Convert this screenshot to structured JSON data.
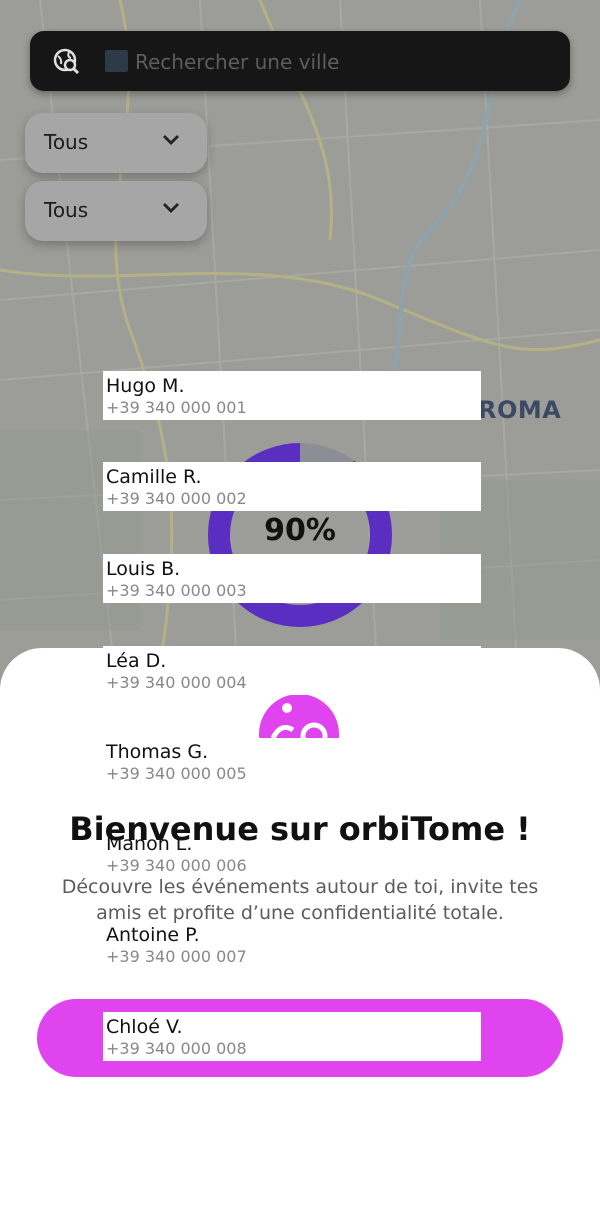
{
  "search": {
    "placeholder": "Rechercher une ville",
    "globe_icon": "globe-search-icon",
    "emoji_icon": "city-emoji-icon"
  },
  "filters": [
    {
      "label": "Tous",
      "icon": "chevron-down-icon"
    },
    {
      "label": "Tous",
      "icon": "chevron-down-icon"
    }
  ],
  "map": {
    "city_label": "ROMA"
  },
  "progress": {
    "label": "90%",
    "value": 0.9,
    "color": "#5b2ec2"
  },
  "contacts": [
    {
      "name": "Hugo M.",
      "phone": "+39 340 000 001"
    },
    {
      "name": "Camille R.",
      "phone": "+39 340 000 002"
    },
    {
      "name": "Louis B.",
      "phone": "+39 340 000 003"
    },
    {
      "name": "Léa D.",
      "phone": "+39 340 000 004"
    },
    {
      "name": "Thomas G.",
      "phone": "+39 340 000 005"
    },
    {
      "name": "Manon L.",
      "phone": "+39 340 000 006"
    },
    {
      "name": "Antoine P.",
      "phone": "+39 340 000 007"
    },
    {
      "name": "Chloé V.",
      "phone": "+39 340 000 008"
    }
  ],
  "welcome": {
    "title": "Bienvenue sur orbiTome !",
    "description": "Découvre les événements autour de toi, invite tes amis et profite d’une confidentialité totale.",
    "logo_icon": "orbitome-logo-icon",
    "brand_color": "#df44ef"
  }
}
